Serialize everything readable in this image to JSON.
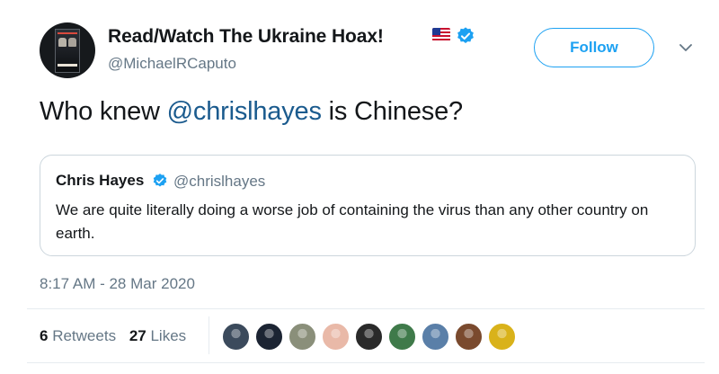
{
  "author": {
    "display_name": "Read/Watch The Ukraine Hoax!",
    "handle": "@MichaelRCaputo",
    "verified": true,
    "flag_icon": "us-flag-icon",
    "avatar_icon": "book-cover-avatar"
  },
  "actions": {
    "follow_label": "Follow",
    "more_icon": "chevron-down-icon"
  },
  "tweet": {
    "text_prefix": "Who knew ",
    "mention": "@chrislhayes",
    "text_suffix": " is Chinese?",
    "timestamp": "8:17 AM - 28 Mar 2020"
  },
  "quoted_tweet": {
    "name": "Chris Hayes",
    "handle": "@chrislhayes",
    "verified": true,
    "text": "We are quite literally doing a worse job of containing the virus than any other country on earth."
  },
  "stats": {
    "retweets_count": "6",
    "retweets_label": "Retweets",
    "likes_count": "27",
    "likes_label": "Likes"
  },
  "likers": [
    {
      "name": "liker-avatar-1",
      "color": "#3b4a5c"
    },
    {
      "name": "liker-avatar-2",
      "color": "#1c2433"
    },
    {
      "name": "liker-avatar-3",
      "color": "#8a8f7a"
    },
    {
      "name": "liker-avatar-4",
      "color": "#e9b9a8"
    },
    {
      "name": "liker-avatar-5",
      "color": "#2a2a2a"
    },
    {
      "name": "liker-avatar-6",
      "color": "#3f7a4a"
    },
    {
      "name": "liker-avatar-7",
      "color": "#5a7fa8"
    },
    {
      "name": "liker-avatar-8",
      "color": "#7a4a2e"
    },
    {
      "name": "liker-avatar-9",
      "color": "#d9b21a"
    }
  ],
  "colors": {
    "link": "#1da1f2",
    "mention": "#1b5b8e",
    "secondary_text": "#657786",
    "border": "#ccd6dd",
    "verified": "#1da1f2"
  }
}
